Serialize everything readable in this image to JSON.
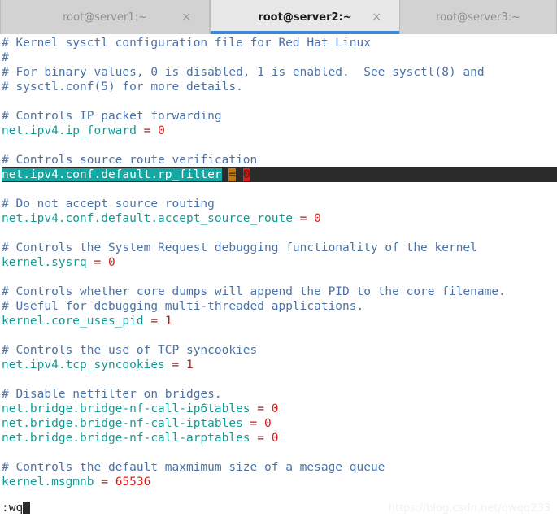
{
  "window": {
    "tabs": [
      {
        "label": "root@server1:~",
        "close_icon": "×",
        "active": false
      },
      {
        "label": "root@server2:~",
        "close_icon": "×",
        "active": true
      },
      {
        "label": "root@server3:~",
        "close_icon": "",
        "active": false
      }
    ]
  },
  "colors": {
    "comment": "#4a72a8",
    "key": "#129b94",
    "equals": "#a81f1f",
    "value": "#e01b1b",
    "selection_key_bg": "#13a9a2",
    "selection_eq_bg": "#c27708",
    "selection_val_bg": "#e01b1b",
    "selection_line_bg": "#2b2b2b",
    "tab_active_underline": "#3d88d8"
  },
  "editor": {
    "lines": [
      {
        "type": "comment",
        "text": "# Kernel sysctl configuration file for Red Hat Linux"
      },
      {
        "type": "comment",
        "text": "#"
      },
      {
        "type": "comment",
        "text": "# For binary values, 0 is disabled, 1 is enabled.  See sysctl(8) and"
      },
      {
        "type": "comment",
        "text": "# sysctl.conf(5) for more details."
      },
      {
        "type": "blank",
        "text": ""
      },
      {
        "type": "comment",
        "text": "# Controls IP packet forwarding"
      },
      {
        "type": "setting",
        "key": "net.ipv4.ip_forward",
        "eq": "=",
        "value": "0"
      },
      {
        "type": "blank",
        "text": ""
      },
      {
        "type": "comment",
        "text": "# Controls source route verification"
      },
      {
        "type": "selected",
        "key": "net.ipv4.conf.default.rp_filter",
        "eq": "=",
        "value": "0"
      },
      {
        "type": "blank",
        "text": ""
      },
      {
        "type": "comment",
        "text": "# Do not accept source routing"
      },
      {
        "type": "setting",
        "key": "net.ipv4.conf.default.accept_source_route",
        "eq": "=",
        "value": "0"
      },
      {
        "type": "blank",
        "text": ""
      },
      {
        "type": "comment",
        "text": "# Controls the System Request debugging functionality of the kernel"
      },
      {
        "type": "setting",
        "key": "kernel.sysrq",
        "eq": "=",
        "value": "0"
      },
      {
        "type": "blank",
        "text": ""
      },
      {
        "type": "comment",
        "text": "# Controls whether core dumps will append the PID to the core filename."
      },
      {
        "type": "comment",
        "text": "# Useful for debugging multi-threaded applications."
      },
      {
        "type": "setting",
        "key": "kernel.core_uses_pid",
        "eq": "=",
        "value": "1",
        "value_dark": true
      },
      {
        "type": "blank",
        "text": ""
      },
      {
        "type": "comment",
        "text": "# Controls the use of TCP syncookies"
      },
      {
        "type": "setting",
        "key": "net.ipv4.tcp_syncookies",
        "eq": "=",
        "value": "1",
        "value_dark": true
      },
      {
        "type": "blank",
        "text": ""
      },
      {
        "type": "comment",
        "text": "# Disable netfilter on bridges."
      },
      {
        "type": "setting",
        "key": "net.bridge.bridge-nf-call-ip6tables",
        "eq": "=",
        "value": "0"
      },
      {
        "type": "setting",
        "key": "net.bridge.bridge-nf-call-iptables",
        "eq": "=",
        "value": "0"
      },
      {
        "type": "setting",
        "key": "net.bridge.bridge-nf-call-arptables",
        "eq": "=",
        "value": "0"
      },
      {
        "type": "blank",
        "text": ""
      },
      {
        "type": "comment",
        "text": "# Controls the default maxmimum size of a mesage queue"
      },
      {
        "type": "setting",
        "key": "kernel.msgmnb",
        "eq": "=",
        "value": "65536"
      }
    ],
    "status_command": ":wq",
    "cursor_icon": "block-cursor"
  },
  "watermark": {
    "text": "https://blog.csdn.net/qwqq233"
  }
}
